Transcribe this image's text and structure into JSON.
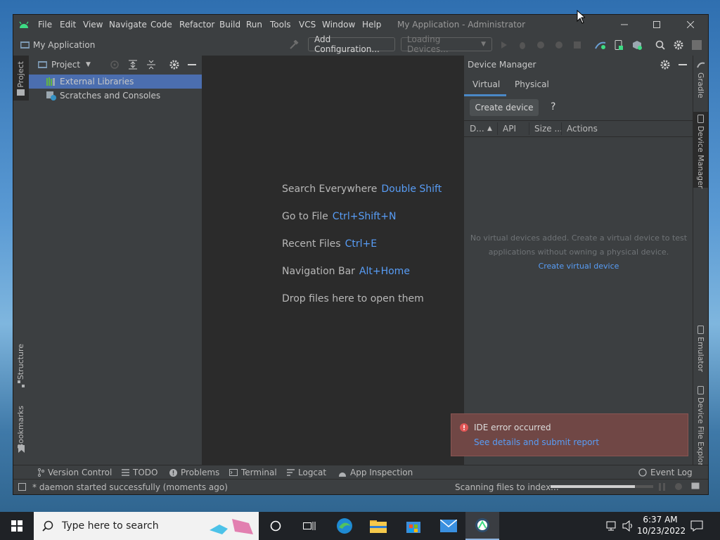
{
  "menu": {
    "items": [
      "File",
      "Edit",
      "View",
      "Navigate",
      "Code",
      "Refactor",
      "Build",
      "Run",
      "Tools",
      "VCS",
      "Window",
      "Help"
    ],
    "window_title": "My Application - Administrator"
  },
  "toolbar": {
    "breadcrumb": "My Application",
    "add_configuration": "Add Configuration...",
    "device_selector": "Loading Devices..."
  },
  "left_stripe": {
    "project": "Project",
    "structure": "Structure",
    "bookmarks": "Bookmarks"
  },
  "project_panel": {
    "view_selector": "Project",
    "tree": [
      "External Libraries",
      "Scratches and Consoles"
    ]
  },
  "editor": {
    "hints": [
      {
        "label": "Search Everywhere",
        "key": "Double Shift"
      },
      {
        "label": "Go to File",
        "key": "Ctrl+Shift+N"
      },
      {
        "label": "Recent Files",
        "key": "Ctrl+E"
      },
      {
        "label": "Navigation Bar",
        "key": "Alt+Home"
      }
    ],
    "drop_text": "Drop files here to open them"
  },
  "device_manager": {
    "title": "Device Manager",
    "tabs": [
      "Virtual",
      "Physical"
    ],
    "create_device": "Create device",
    "help": "?",
    "columns": [
      "D...",
      "API",
      "Size ...",
      "Actions"
    ],
    "empty_line1": "No virtual devices added. Create a virtual device to test",
    "empty_line2": "applications without owning a physical device.",
    "create_link": "Create virtual device"
  },
  "right_stripe": {
    "gradle": "Gradle",
    "device_manager": "Device Manager",
    "emulator": "Emulator",
    "device_file_explorer": "Device File Explorer"
  },
  "bottom_bar": {
    "version_control": "Version Control",
    "todo": "TODO",
    "problems": "Problems",
    "terminal": "Terminal",
    "logcat": "Logcat",
    "app_inspection": "App Inspection",
    "event_log": "Event Log"
  },
  "status": {
    "message": "* daemon started successfully (moments ago)",
    "indexing": "Scanning files to index...",
    "progress": 0.82
  },
  "notification": {
    "title": "IDE error occurred",
    "link": "See details and submit report"
  },
  "taskbar": {
    "search_placeholder": "Type here to search",
    "time": "6:37 AM",
    "date": "10/23/2022"
  },
  "colors": {
    "accent_blue": "#589df6",
    "selection": "#4b6eaf",
    "error_bg": "#704745",
    "error_icon": "#e05555"
  }
}
